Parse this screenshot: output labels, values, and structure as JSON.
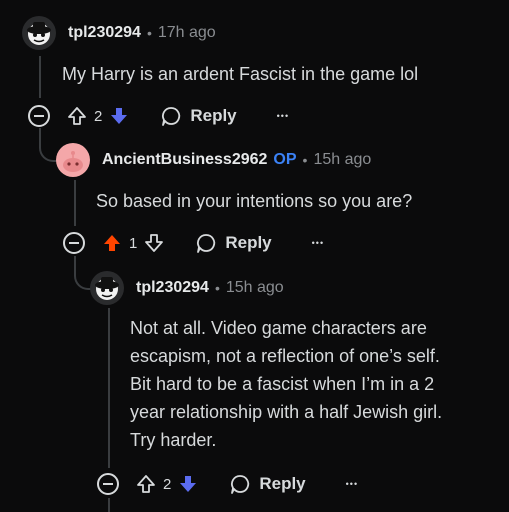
{
  "colors": {
    "upvote_active": "#ff4500",
    "downvote_active": "#5b6cf0",
    "op_badge": "#3b82f6"
  },
  "comments": [
    {
      "username": "tpl230294",
      "separator": "•",
      "time": "17h ago",
      "body": "My Harry is an ardent Fascist in the game lol",
      "votes": "2",
      "vote_state": "downvoted",
      "reply_label": "Reply",
      "more_label": "•••"
    },
    {
      "username": "AncientBusiness2962",
      "op_badge": "OP",
      "separator": "•",
      "time": "15h ago",
      "body": "So based in your intentions so you are?",
      "votes": "1",
      "vote_state": "upvoted",
      "reply_label": "Reply",
      "more_label": "•••"
    },
    {
      "username": "tpl230294",
      "separator": "•",
      "time": "15h ago",
      "body_lines": [
        "Not at all. Video game characters are",
        "escapism, not a reflection of one’s self.",
        "Bit hard to be a fascist when I’m in a 2",
        "year relationship with a half Jewish girl.",
        "Try harder."
      ],
      "votes": "2",
      "vote_state": "downvoted",
      "reply_label": "Reply",
      "more_label": "•••"
    }
  ]
}
